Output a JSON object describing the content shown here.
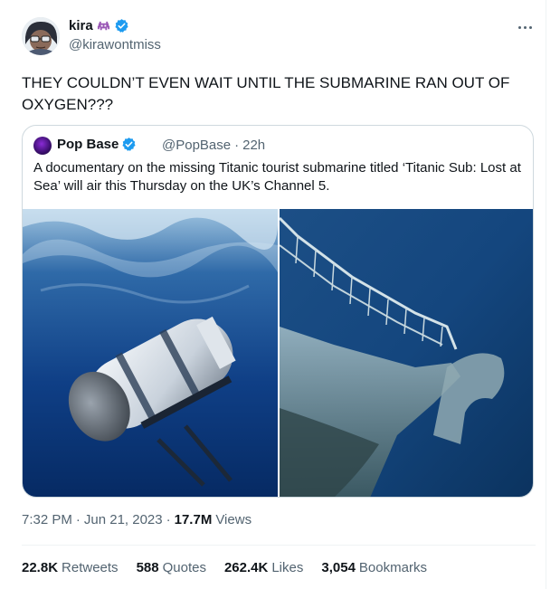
{
  "author": {
    "name": "kira",
    "handle": "@kirawontmiss"
  },
  "tweet": {
    "text": "THEY COULDN’T EVEN WAIT UNTIL THE SUBMARINE RAN OUT OF OXYGEN???"
  },
  "quoted": {
    "name": "Pop Base",
    "handle": "@PopBase",
    "separator": "·",
    "time": "22h",
    "text": "A documentary on the missing Titanic tourist submarine titled ‘Titanic Sub: Lost at Sea’ will air this Thursday on the UK’s Channel 5."
  },
  "meta": {
    "time": "7:32 PM",
    "separator1": "·",
    "date": "Jun 21, 2023",
    "separator2": "·",
    "views_count": "17.7M",
    "views_label": "Views"
  },
  "stats": [
    {
      "count": "22.8K",
      "label": "Retweets"
    },
    {
      "count": "588",
      "label": "Quotes"
    },
    {
      "count": "262.4K",
      "label": "Likes"
    },
    {
      "count": "3,054",
      "label": "Bookmarks"
    }
  ],
  "icons": {
    "author_emoji": "alien-monster-icon",
    "verified": "verified-badge-icon",
    "more": "more-icon"
  },
  "colors": {
    "text_primary": "#0f1419",
    "text_secondary": "#536471",
    "verified_blue": "#1d9bf0",
    "border": "#cfd9de",
    "emoji_purple": "#9b59b6"
  }
}
